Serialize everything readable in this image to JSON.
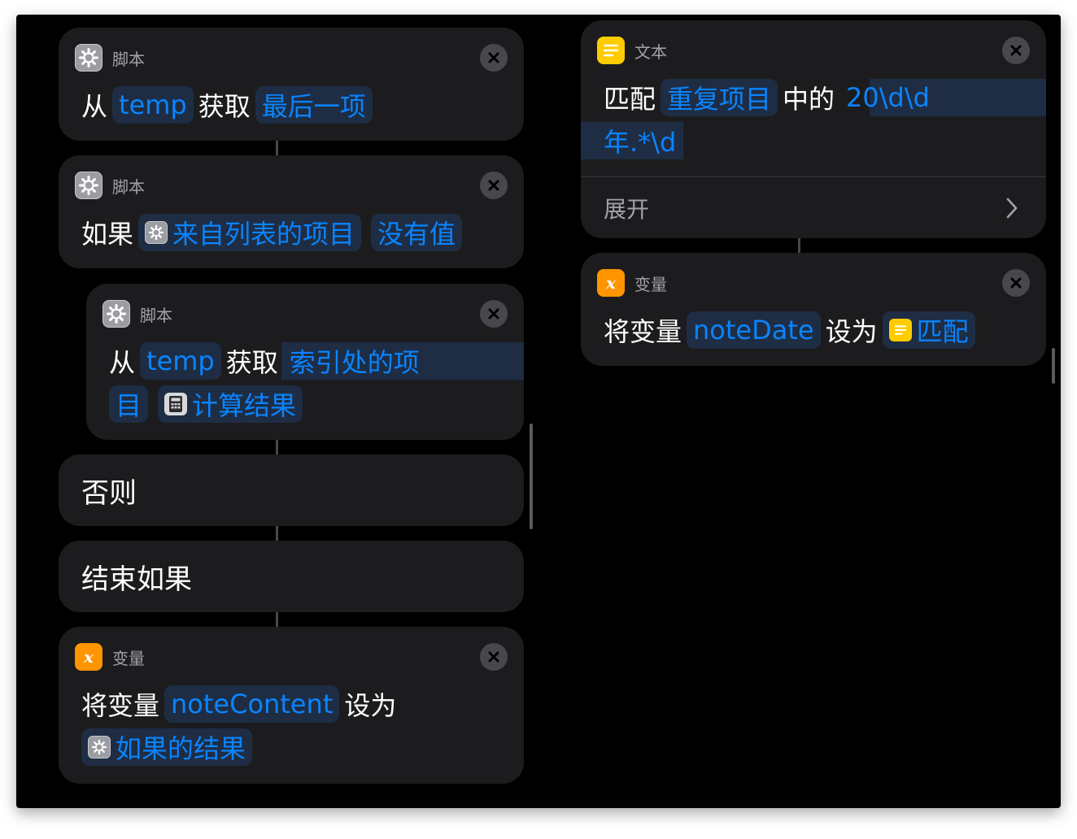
{
  "left_column": {
    "card1": {
      "category": "脚本",
      "words": [
        "从",
        "获取"
      ],
      "tokens": [
        "temp",
        "最后一项"
      ]
    },
    "card2": {
      "category": "脚本",
      "words": [
        "如果"
      ],
      "tokens": [
        "来自列表的项目",
        "没有值"
      ]
    },
    "card3": {
      "category": "脚本",
      "words": [
        "从",
        "获取"
      ],
      "tokens": [
        "temp",
        "索引处的项",
        "目",
        "计算结果"
      ]
    },
    "card4": {
      "title": "否则"
    },
    "card5": {
      "title": "结束如果"
    },
    "card6": {
      "category": "变量",
      "words": [
        "将变量",
        "设为"
      ],
      "tokens": [
        "noteContent",
        "如果的结果"
      ]
    }
  },
  "right_column": {
    "card1": {
      "category": "文本",
      "words": [
        "匹配",
        "中的"
      ],
      "tokens": [
        "重复项目",
        "20\\d\\d",
        "年.*\\d"
      ],
      "expand_label": "展开"
    },
    "card2": {
      "category": "变量",
      "words": [
        "将变量",
        "设为"
      ],
      "tokens": [
        "noteDate",
        "匹配"
      ]
    }
  },
  "icons": {
    "script": "gear-icon",
    "text": "text-lines-icon",
    "variable": "variable-x-icon",
    "calculator": "calculator-icon",
    "close": "close-icon",
    "chevron": "chevron-right-icon"
  },
  "colors": {
    "background": "#000000",
    "card": "#1c1c1e",
    "token_text": "#0a84ff",
    "token_bg": "#1e2d44",
    "text_icon": "#ffcc00",
    "variable_icon": "#ff9500"
  }
}
